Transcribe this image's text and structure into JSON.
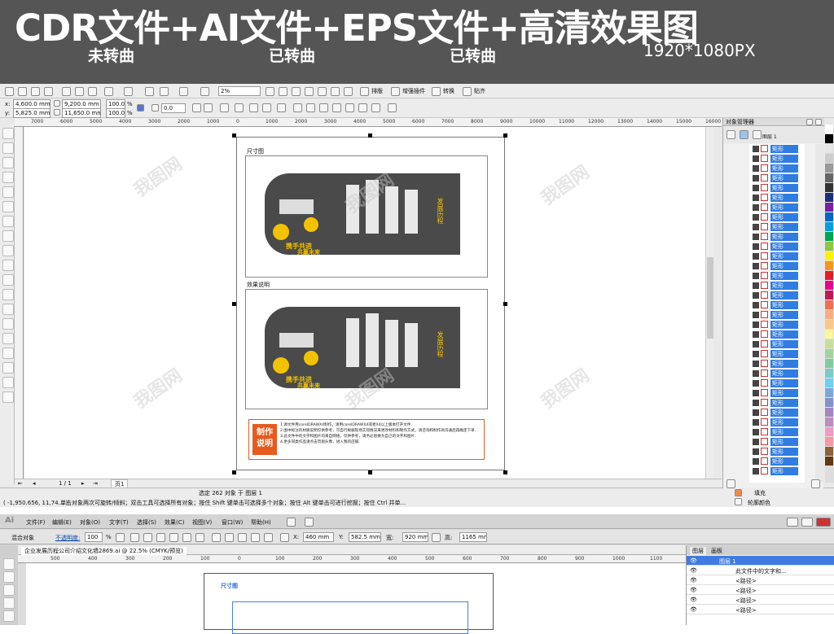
{
  "banner": {
    "title": "CDR文件+AI文件+EPS文件+高清效果图",
    "sub1": "未转曲",
    "sub2": "已转曲",
    "sub3": "已转曲",
    "resolution": "1920*1080PX"
  },
  "cdr": {
    "zoom": "2%",
    "toolbar_items": [
      "排版",
      "增强插件",
      "转换",
      "贴齐"
    ],
    "x": "4,600.0 mm",
    "y": "5,825.0 mm",
    "w": "9,200.0 mm",
    "h": "11,650.0 mm",
    "scale_x": "100.0",
    "scale_y": "100.0",
    "pct": "%",
    "angle": "0.0",
    "ruler_ticks": [
      "7000",
      "6000",
      "5000",
      "4000",
      "3000",
      "2000",
      "1000",
      "0",
      "1000",
      "2000",
      "3000",
      "4000",
      "5000",
      "6000",
      "7000",
      "8000",
      "9000",
      "10000",
      "11000",
      "12000",
      "13000",
      "14000",
      "15000",
      "16000"
    ],
    "section1_label": "尺寸图",
    "section2_label": "效果说明",
    "wall_text_title": "发展历程",
    "wall_text_slogan1": "携手共进",
    "wall_text_slogan2": "共赢未来",
    "note_badge": "制作\n说明",
    "note_lines": [
      "1.源文件用coreIDRAWX4制作，请用coreIDRAWX4或者X4以上版本打开文件.",
      "2.图中标注的材质说明仅供参考，可自行根据现场实际情况来更改材料和制作方式，请咨询和制作商沟通后再确定下单.",
      "3.此文件中的文字和图片均来自网络，仅供参考，请务必替换为自己的文字和图片.",
      "4.更多同类作品请点击页眉头像，进入我的店铺."
    ],
    "page_nav": "1 / 1",
    "page_tab": "页1",
    "status_selection": "选定 262 对象 于 图层 1",
    "status_coords": "( -1,950.656, 11,74... )",
    "status_hint": "单击对象两次可旋转/倾斜；双击工具可选择所有对象；按住 Shift 键单击可选择多个对象；按住 Alt 键单击可进行挖掘；按住 Ctrl 并单...",
    "fill_label": "填充",
    "outline_label": "轮廓颜色",
    "obj_manager_title": "对象管理器",
    "obj_layer": "图层 1",
    "obj_row_label": "矩形",
    "obj_row_count": 34,
    "palette": [
      "#ffffff",
      "#000000",
      "#e6e6e6",
      "#cccccc",
      "#999999",
      "#666666",
      "#333333",
      "#1d2f7a",
      "#7a1fa0",
      "#0066cc",
      "#00a0e0",
      "#00a651",
      "#8dc63f",
      "#fff200",
      "#f7941d",
      "#ed1c24",
      "#ec008c",
      "#c2185b",
      "#f26c4f",
      "#f9ad81",
      "#fdc689",
      "#fff799",
      "#c4df9b",
      "#a2d39c",
      "#82ca9c",
      "#7accc8",
      "#6dcff6",
      "#7da7d9",
      "#8393ca",
      "#a187be",
      "#bc8dbf",
      "#f49ac2",
      "#f6989d",
      "#8c6239",
      "#603913"
    ]
  },
  "ai": {
    "menu": [
      "文件(F)",
      "编辑(E)",
      "对象(O)",
      "文字(T)",
      "选择(S)",
      "效果(C)",
      "视图(V)",
      "窗口(W)",
      "帮助(H)"
    ],
    "ctrl_label": "混合对象",
    "opacity_label": "不透明度:",
    "opacity": "100",
    "opacity_pct": "%",
    "x_label": "X:",
    "x": "460 mm",
    "y_label": "Y:",
    "y": "582.5 mm",
    "w_label": "宽:",
    "w": "920 mm",
    "h_label": "高:",
    "h": "1165 mm",
    "doc_tab": "企业发展历程公司介绍文化墙2869.ai @ 22.5% (CMYK/预览)",
    "ruler_ticks": [
      "500",
      "400",
      "300",
      "200",
      "100",
      "0",
      "100",
      "200",
      "300",
      "400",
      "500",
      "600",
      "700",
      "800",
      "900",
      "1000",
      "1100",
      "15"
    ],
    "section_label": "尺寸图",
    "layers_tab1": "图层",
    "layers_tab2": "画板",
    "layer_name": "图层 1",
    "layer_rows": [
      "此文件中的文字和...",
      "<路径>",
      "<路径>",
      "<路径>",
      "<路径>"
    ]
  },
  "watermark": "我图网",
  "chart_data": null
}
